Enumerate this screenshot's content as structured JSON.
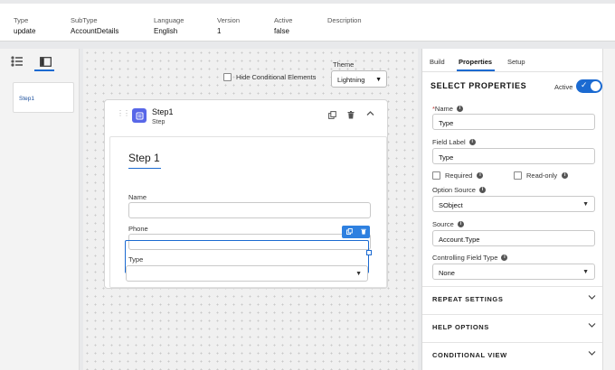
{
  "header": {
    "columns": [
      {
        "label": "Type",
        "value": "update"
      },
      {
        "label": "SubType",
        "value": "AccountDetails"
      },
      {
        "label": "Language",
        "value": "English"
      },
      {
        "label": "Version",
        "value": "1"
      },
      {
        "label": "Active",
        "value": "false"
      },
      {
        "label": "Description",
        "value": ""
      }
    ]
  },
  "leftbar": {
    "icons": [
      "tree-list-icon",
      "panel-layout-icon"
    ],
    "steps": [
      {
        "label": "Step1"
      }
    ]
  },
  "canvas": {
    "hide_conditional_label": "Hide Conditional Elements",
    "theme_label": "Theme",
    "theme_value": "Lightning",
    "step": {
      "title": "Step1",
      "subtitle": "Step",
      "form_title": "Step 1",
      "fields": [
        {
          "label": "Name",
          "kind": "text"
        },
        {
          "label": "Phone",
          "kind": "text"
        },
        {
          "label": "Type",
          "kind": "select"
        }
      ]
    }
  },
  "panel": {
    "tabs": [
      {
        "label": "Build"
      },
      {
        "label": "Properties",
        "active": true
      },
      {
        "label": "Setup"
      }
    ],
    "section_title": "SELECT PROPERTIES",
    "active_label": "Active",
    "active_value": true,
    "name_label": "Name",
    "name_value": "Type",
    "field_label_label": "Field Label",
    "field_label_value": "Type",
    "required_label": "Required",
    "readonly_label": "Read-only",
    "option_source_label": "Option Source",
    "option_source_value": "SObject",
    "source_label": "Source",
    "source_value": "Account.Type",
    "controlling_label": "Controlling Field Type",
    "controlling_value": "None",
    "accordions": [
      {
        "label": "REPEAT SETTINGS"
      },
      {
        "label": "HELP OPTIONS"
      },
      {
        "label": "CONDITIONAL VIEW"
      }
    ]
  },
  "colors": {
    "accent": "#1b6ad1",
    "step_icon": "#5867e8",
    "required": "#c23934"
  }
}
